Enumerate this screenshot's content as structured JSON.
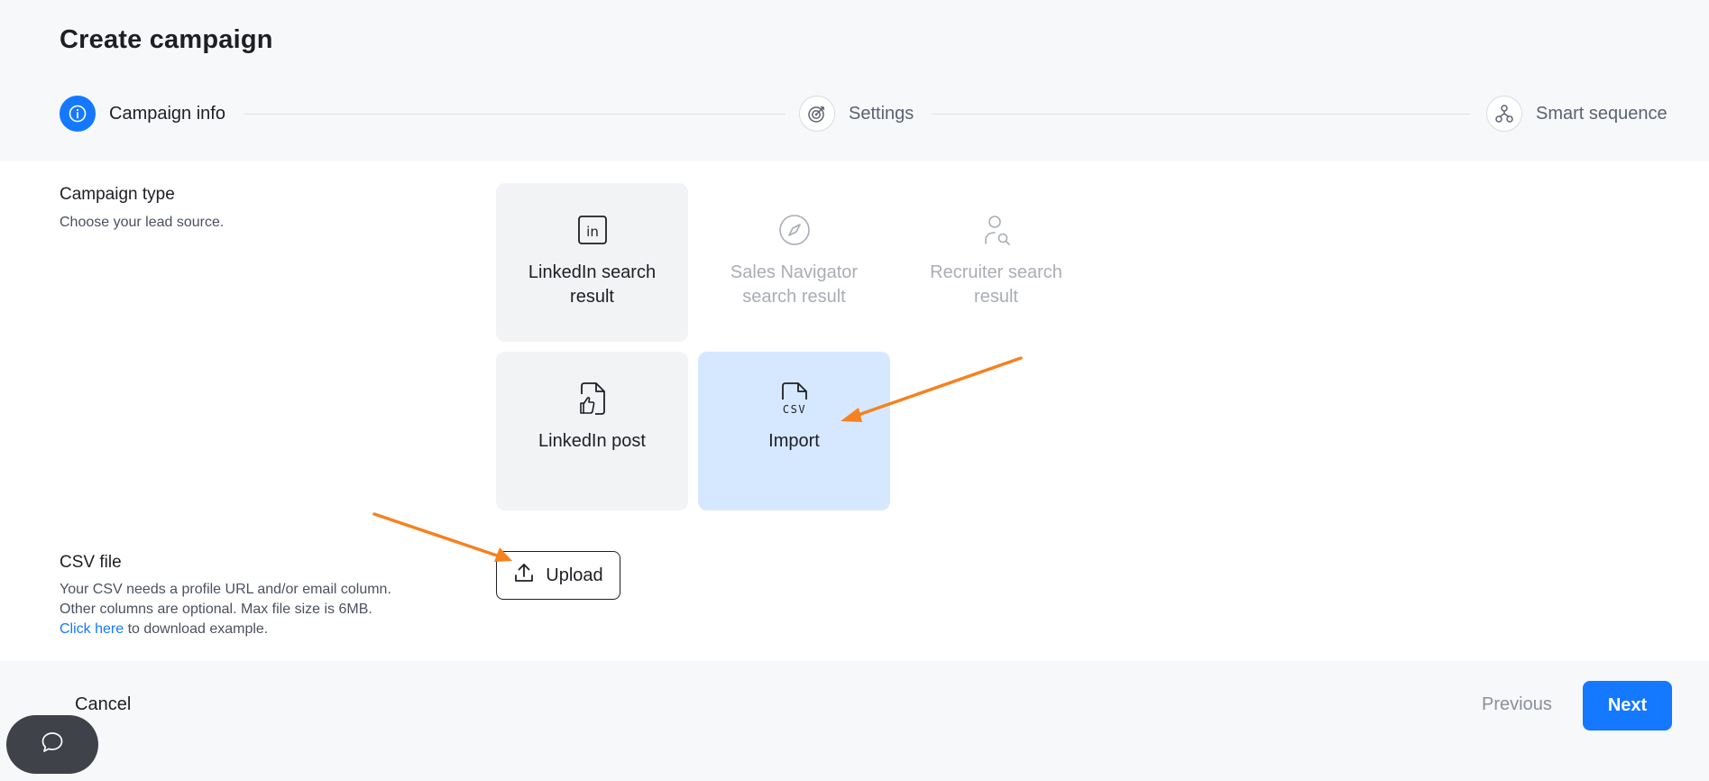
{
  "page": {
    "title": "Create campaign"
  },
  "stepper": {
    "steps": [
      {
        "label": "Campaign info",
        "icon": "info-icon",
        "active": true
      },
      {
        "label": "Settings",
        "icon": "target-icon",
        "active": false
      },
      {
        "label": "Smart sequence",
        "icon": "sequence-icon",
        "active": false
      }
    ]
  },
  "campaign_type": {
    "title": "Campaign type",
    "description": "Choose your lead source.",
    "options": [
      {
        "label": "LinkedIn search result",
        "icon": "linkedin-icon",
        "state": "enabled"
      },
      {
        "label": "Sales Navigator search result",
        "icon": "compass-icon",
        "state": "disabled"
      },
      {
        "label": "Recruiter search result",
        "icon": "user-search-icon",
        "state": "disabled"
      },
      {
        "label": "LinkedIn post",
        "icon": "file-thumbs-up-icon",
        "state": "enabled"
      },
      {
        "label": "Import",
        "icon": "csv-file-icon",
        "state": "selected"
      }
    ]
  },
  "csv_file": {
    "title": "CSV file",
    "line1": "Your CSV needs a profile URL and/or email column.",
    "line2": "Other columns are optional. Max file size is 6MB.",
    "link_text": "Click here",
    "line3_rest": " to download example.",
    "upload_label": "Upload"
  },
  "footer": {
    "cancel_label": "Cancel",
    "previous_label": "Previous",
    "next_label": "Next"
  },
  "colors": {
    "primary": "#1479ff",
    "selected_card": "#d6e8ff",
    "annotation_arrow": "#f5821f"
  }
}
